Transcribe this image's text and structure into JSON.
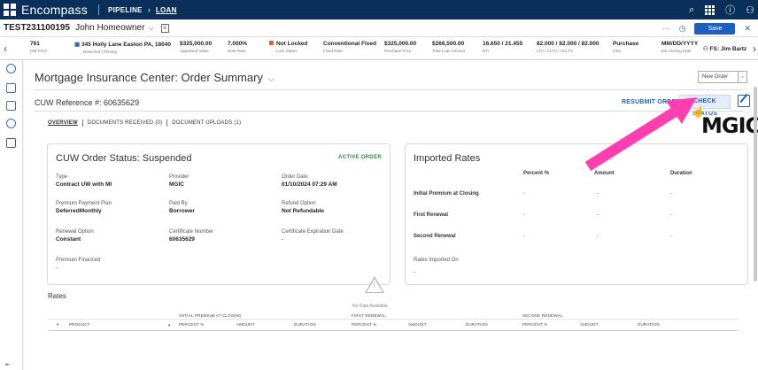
{
  "app": {
    "brand": "Encompass",
    "crumb_pipeline": "PIPELINE",
    "crumb_loan": "LOAN"
  },
  "loan": {
    "number": "TEST231100195",
    "borrower": "John Homeowner",
    "save_label": "Save"
  },
  "summary": [
    {
      "value": "761",
      "label": "Mid-FICO"
    },
    {
      "value": "345 Holly Lane Easton PA, 18040",
      "label": "Detached | Primary"
    },
    {
      "value": "$325,000.00",
      "label": "Appraised Value"
    },
    {
      "value": "7.000%",
      "label": "Note Rate"
    },
    {
      "value": "Not Locked",
      "label": "Lock Status"
    },
    {
      "value": "Conventional Fixed",
      "label": "Fixed Rate"
    },
    {
      "value": "$325,000.00",
      "label": "Purchase Price"
    },
    {
      "value": "$266,500.00",
      "label": "Total Loan Amount"
    },
    {
      "value": "16.650 / 21.455",
      "label": "DTI"
    },
    {
      "value": "82.000 / 82.000 / 82.000",
      "label": "LTV / CLTV / HCLTV"
    },
    {
      "value": "Purchase",
      "label": "First"
    },
    {
      "value": "MM/DD/YYYY",
      "label": "Est Closing Date"
    },
    {
      "value": "FS: Jim Bartz",
      "label": ""
    }
  ],
  "page": {
    "title": "Mortgage Insurance Center: Order Summary",
    "new_order": "New Order",
    "cuw_reference": "CUW Reference #: 60635629",
    "resubmit": "RESUBMIT ORDER",
    "check_status": "CHECK STATUS",
    "logo_text": "MGIC"
  },
  "tabs": [
    "OVERVIEW",
    "DOCUMENTS RECEIVED (0)",
    "DOCUMENT UPLOADS (1)"
  ],
  "status_card": {
    "title": "CUW Order Status: Suspended",
    "badge": "ACTIVE ORDER",
    "fields": [
      {
        "k": "Type",
        "v": "Contract UW with MI"
      },
      {
        "k": "Provider",
        "v": "MGIC"
      },
      {
        "k": "Order Date",
        "v": "01/10/2024 07:29 AM"
      },
      {
        "k": "Premium Payment Plan",
        "v": "DeferredMonthly"
      },
      {
        "k": "Paid By",
        "v": "Borrower"
      },
      {
        "k": "Refund Option",
        "v": "Not Refundable"
      },
      {
        "k": "Renewal Option",
        "v": "Constant"
      },
      {
        "k": "Certificate Number",
        "v": "60635629"
      },
      {
        "k": "Certificate Expiration Date",
        "v": "-"
      },
      {
        "k": "Premium Financed",
        "v": "-"
      }
    ]
  },
  "imported_rates": {
    "title": "Imported Rates",
    "columns": [
      "Percent %",
      "Amount",
      "Duration"
    ],
    "rows": [
      {
        "label": "Initial Premium at Closing",
        "cells": [
          "-",
          "-",
          "-"
        ]
      },
      {
        "label": "First Renewal",
        "cells": [
          "-",
          "-",
          "-"
        ]
      },
      {
        "label": "Second Renewal",
        "cells": [
          "-",
          "-",
          "-"
        ]
      }
    ],
    "imported_on_label": "Rates Imported On",
    "imported_on_value": "-"
  },
  "rates_table": {
    "title": "Rates",
    "groups": [
      "INITIAL PREMIUM AT CLOSING",
      "FIRST RENEWAL",
      "SECOND RENEWAL"
    ],
    "headers": [
      "PRODUCT",
      "PERCENT %",
      "AMOUNT",
      "DURATION",
      "PERCENT %",
      "AMOUNT",
      "DURATION",
      "PERCENT %",
      "AMOUNT",
      "DURATION"
    ],
    "empty_text": "No Data Available"
  },
  "colors": {
    "topbar": "#0b2f5b",
    "accent": "#1f5fbf",
    "active_badge": "#2d8a45",
    "annotation_arrow": "#ff3fb0"
  }
}
